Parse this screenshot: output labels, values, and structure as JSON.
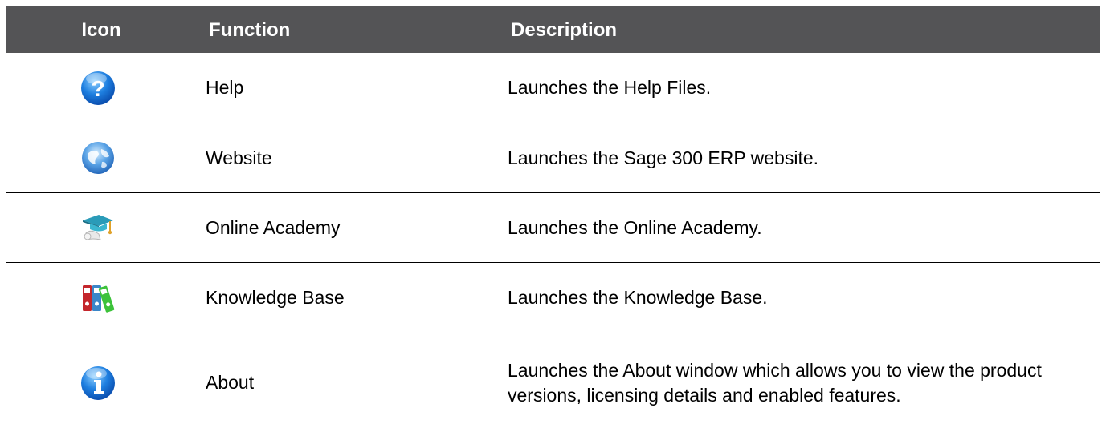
{
  "table": {
    "headers": {
      "icon": "Icon",
      "function": "Function",
      "description": "Description"
    },
    "rows": [
      {
        "icon": "help-icon",
        "function": "Help",
        "description": "Launches the Help Files."
      },
      {
        "icon": "globe-icon",
        "function": "Website",
        "description": "Launches the Sage 300 ERP website."
      },
      {
        "icon": "graduation-cap-icon",
        "function": "Online Academy",
        "description": "Launches the Online Academy."
      },
      {
        "icon": "binders-icon",
        "function": "Knowledge Base",
        "description": "Launches the Knowledge Base."
      },
      {
        "icon": "info-icon",
        "function": "About",
        "description": "Launches the About window which allows you to view the product versions, licensing details and enabled features."
      }
    ]
  },
  "colors": {
    "header_bg": "#545456",
    "header_text": "#ffffff",
    "rule": "#000000"
  }
}
